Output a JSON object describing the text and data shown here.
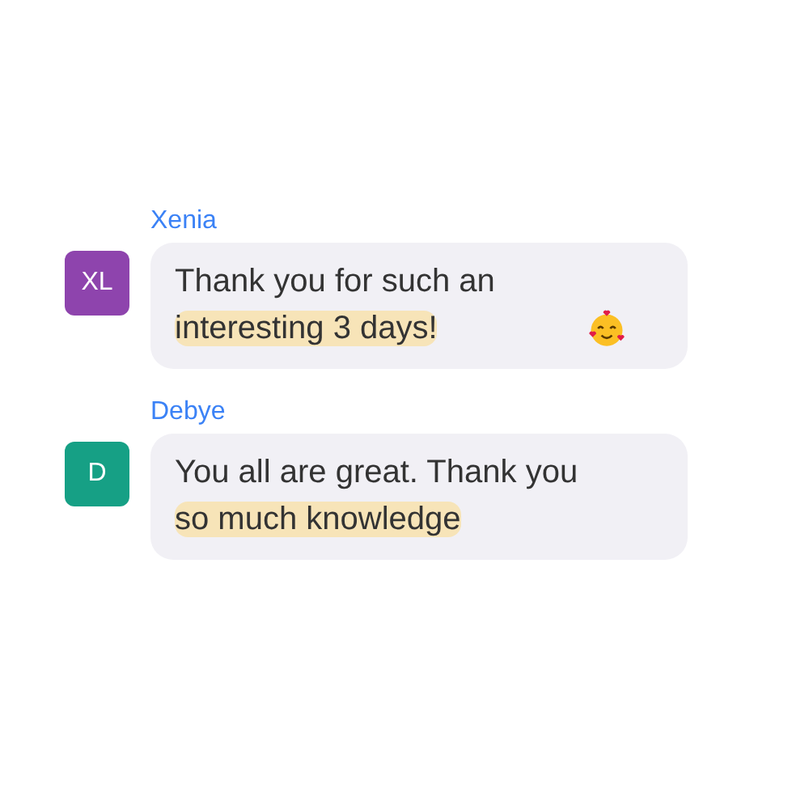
{
  "messages": [
    {
      "sender": "Xenia",
      "initials": "XL",
      "color": "#8e44ad",
      "segments": [
        {
          "text": "Thank you for such an ",
          "highlighted": false
        },
        {
          "text": "interesting 3 days!",
          "highlighted": true
        }
      ],
      "emoji": true
    },
    {
      "sender": "Debye",
      "initials": "D",
      "color": "#16a085",
      "segments": [
        {
          "text": "You all are great. Thank you ",
          "highlighted": false
        },
        {
          "text": "so much knowledge",
          "highlighted": true
        }
      ],
      "emoji": false
    }
  ]
}
